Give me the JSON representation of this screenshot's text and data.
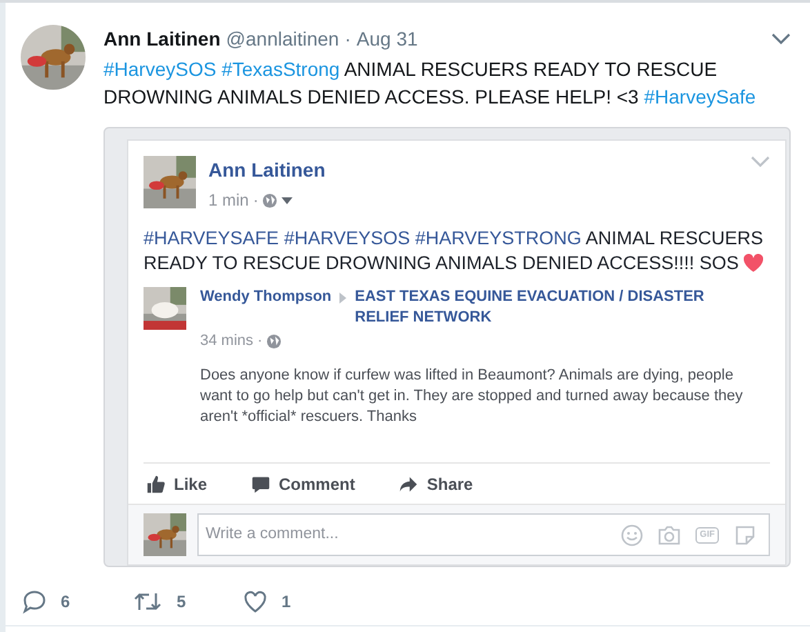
{
  "tweet": {
    "name": "Ann Laitinen",
    "handle": "@annlaitinen",
    "separator": "·",
    "date": "Aug 31",
    "text": [
      {
        "kind": "hashtag",
        "text": "#HarveySOS"
      },
      {
        "kind": "hashtag",
        "text": "#TexasStrong"
      },
      {
        "kind": "plain",
        "text": "ANIMAL RESCUERS READY TO RESCUE DROWNING ANIMALS DENIED ACCESS. PLEASE HELP! <3"
      },
      {
        "kind": "hashtag",
        "text": "#HarveySafe"
      }
    ]
  },
  "fb_post": {
    "name": "Ann Laitinen",
    "time": "1 min",
    "separator": "·",
    "text": [
      {
        "kind": "hashtag",
        "text": "#HARVEYSAFE"
      },
      {
        "kind": "hashtag",
        "text": "#HARVEYSOS"
      },
      {
        "kind": "hashtag",
        "text": "#HARVEYSTRONG"
      },
      {
        "kind": "plain",
        "text": "ANIMAL RESCUERS READY TO RESCUE DROWNING ANIMALS DENIED ACCESS!!!! SOS"
      }
    ],
    "shared": {
      "name": "Wendy Thompson",
      "group": "EAST TEXAS EQUINE EVACUATION / DISASTER RELIEF NETWORK",
      "time": "34 mins",
      "separator": "·",
      "text": "Does anyone know if curfew was lifted in Beaumont? Animals are dying, people want to go help but can't get in. They are stopped and turned away because they aren't *official* rescuers. Thanks"
    },
    "actions": [
      "Like",
      "Comment",
      "Share"
    ],
    "comment": {
      "placeholder": "Write a comment...",
      "gif_label": "GIF"
    }
  },
  "tweet_actions": [
    {
      "kind": "reply",
      "count": "6"
    },
    {
      "kind": "retweet",
      "count": "5"
    },
    {
      "kind": "like",
      "count": "1"
    }
  ]
}
